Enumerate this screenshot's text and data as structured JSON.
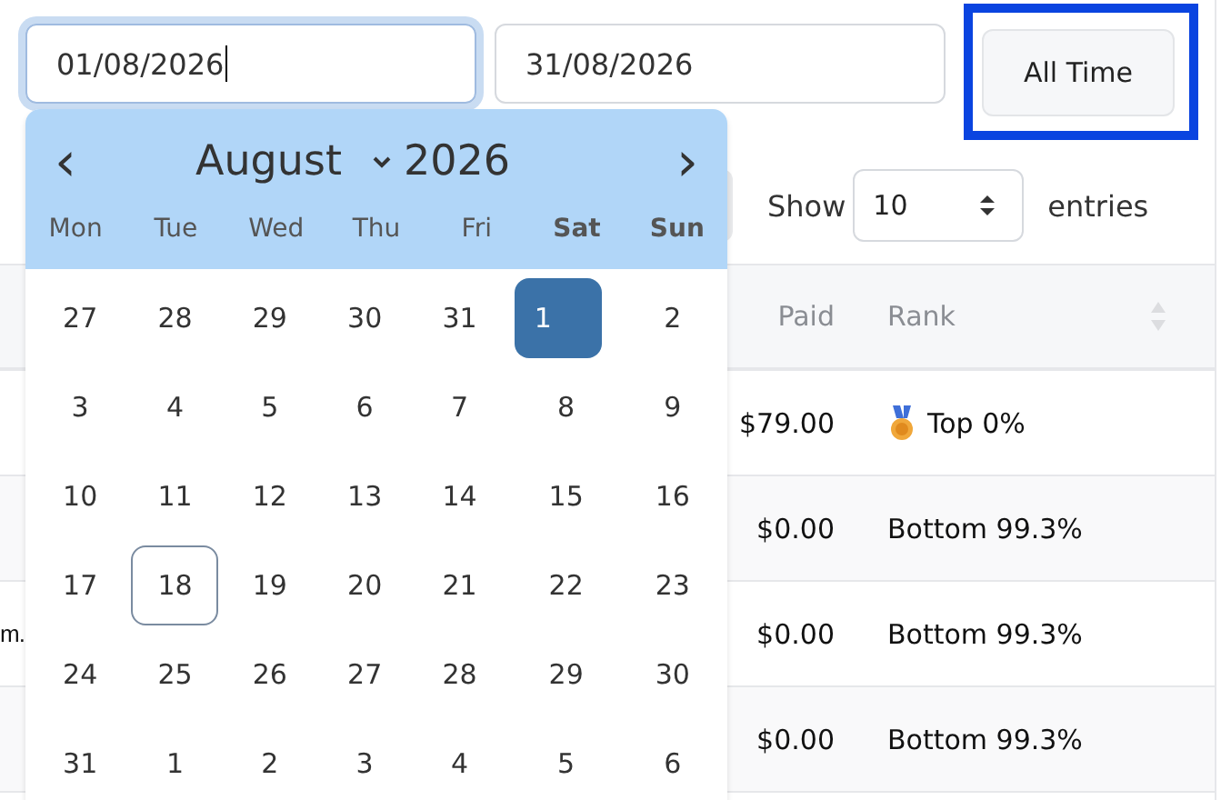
{
  "date_from": {
    "value": "01/08/2026",
    "focused": true
  },
  "date_to": {
    "value": "31/08/2026"
  },
  "all_time_button": {
    "label": "All Time",
    "highlighted": true
  },
  "show_entries": {
    "label_before": "Show",
    "value": "10",
    "label_after": "entries"
  },
  "table": {
    "columns": [
      {
        "label": "Paid"
      },
      {
        "label": "Rank"
      }
    ],
    "rows": [
      {
        "column_1": "",
        "paid": "$79.00",
        "rank": "Top 0%",
        "medal": true
      },
      {
        "column_1": "",
        "paid": "$0.00",
        "rank": "Bottom 99.3%",
        "medal": false
      },
      {
        "column_1": "m.",
        "paid": "$0.00",
        "rank": "Bottom 99.3%",
        "medal": false
      },
      {
        "column_1": "",
        "paid": "$0.00",
        "rank": "Bottom 99.3%",
        "medal": false
      }
    ]
  },
  "calendar": {
    "prev": "‹",
    "next": "›",
    "month": "August",
    "year": "2026",
    "weekdays": [
      {
        "label": "Mon",
        "weekend": false
      },
      {
        "label": "Tue",
        "weekend": false
      },
      {
        "label": "Wed",
        "weekend": false
      },
      {
        "label": "Thu",
        "weekend": false
      },
      {
        "label": "Fri",
        "weekend": false
      },
      {
        "label": "Sat",
        "weekend": true
      },
      {
        "label": "Sun",
        "weekend": true
      }
    ],
    "days": [
      {
        "label": "27",
        "selected": false,
        "today": false
      },
      {
        "label": "28",
        "selected": false,
        "today": false
      },
      {
        "label": "29",
        "selected": false,
        "today": false
      },
      {
        "label": "30",
        "selected": false,
        "today": false
      },
      {
        "label": "31",
        "selected": false,
        "today": false
      },
      {
        "label": "1",
        "selected": true,
        "today": false
      },
      {
        "label": "2",
        "selected": false,
        "today": false
      },
      {
        "label": "3",
        "selected": false,
        "today": false
      },
      {
        "label": "4",
        "selected": false,
        "today": false
      },
      {
        "label": "5",
        "selected": false,
        "today": false
      },
      {
        "label": "6",
        "selected": false,
        "today": false
      },
      {
        "label": "7",
        "selected": false,
        "today": false
      },
      {
        "label": "8",
        "selected": false,
        "today": false
      },
      {
        "label": "9",
        "selected": false,
        "today": false
      },
      {
        "label": "10",
        "selected": false,
        "today": false
      },
      {
        "label": "11",
        "selected": false,
        "today": false
      },
      {
        "label": "12",
        "selected": false,
        "today": false
      },
      {
        "label": "13",
        "selected": false,
        "today": false
      },
      {
        "label": "14",
        "selected": false,
        "today": false
      },
      {
        "label": "15",
        "selected": false,
        "today": false
      },
      {
        "label": "16",
        "selected": false,
        "today": false
      },
      {
        "label": "17",
        "selected": false,
        "today": false
      },
      {
        "label": "18",
        "selected": false,
        "today": true
      },
      {
        "label": "19",
        "selected": false,
        "today": false
      },
      {
        "label": "20",
        "selected": false,
        "today": false
      },
      {
        "label": "21",
        "selected": false,
        "today": false
      },
      {
        "label": "22",
        "selected": false,
        "today": false
      },
      {
        "label": "23",
        "selected": false,
        "today": false
      },
      {
        "label": "24",
        "selected": false,
        "today": false
      },
      {
        "label": "25",
        "selected": false,
        "today": false
      },
      {
        "label": "26",
        "selected": false,
        "today": false
      },
      {
        "label": "27",
        "selected": false,
        "today": false
      },
      {
        "label": "28",
        "selected": false,
        "today": false
      },
      {
        "label": "29",
        "selected": false,
        "today": false
      },
      {
        "label": "30",
        "selected": false,
        "today": false
      },
      {
        "label": "31",
        "selected": false,
        "today": false
      },
      {
        "label": "1",
        "selected": false,
        "today": false
      },
      {
        "label": "2",
        "selected": false,
        "today": false
      },
      {
        "label": "3",
        "selected": false,
        "today": false
      },
      {
        "label": "4",
        "selected": false,
        "today": false
      },
      {
        "label": "5",
        "selected": false,
        "today": false
      },
      {
        "label": "6",
        "selected": false,
        "today": false
      }
    ]
  }
}
